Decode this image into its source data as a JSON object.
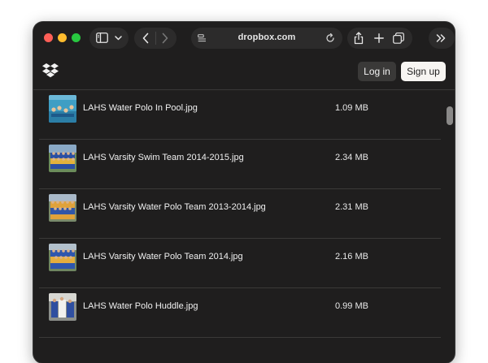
{
  "browser": {
    "address": "dropbox.com"
  },
  "site": {
    "login_label": "Log in",
    "signup_label": "Sign up"
  },
  "files": [
    {
      "name": "LAHS Water Polo In Pool.jpg",
      "size": "1.09 MB",
      "thumb": "pool"
    },
    {
      "name": "LAHS Varsity Swim Team 2014-2015.jpg",
      "size": "2.34 MB",
      "thumb": "team"
    },
    {
      "name": "LAHS Varsity Water Polo Team 2013-2014.jpg",
      "size": "2.31 MB",
      "thumb": "team"
    },
    {
      "name": "LAHS Varsity Water Polo Team 2014.jpg",
      "size": "2.16 MB",
      "thumb": "team"
    },
    {
      "name": "LAHS Water Polo Huddle.jpg",
      "size": "0.99 MB",
      "thumb": "huddle"
    }
  ],
  "icons": {
    "sidebar": "sidebar-icon",
    "chevron": "chevron-down-icon",
    "back": "back-icon",
    "forward": "forward-icon",
    "reader": "reader-icon",
    "reload": "reload-icon",
    "share": "share-icon",
    "new_tab": "plus-icon",
    "tabs": "tabs-overview-icon",
    "more": "double-chevron-icon",
    "logo": "dropbox-logo-icon"
  },
  "colors": {
    "background": "#1f1e1e",
    "row_divider": "#3a3938",
    "text": "#f0f0f0",
    "signup_bg": "#f7f5f2"
  }
}
